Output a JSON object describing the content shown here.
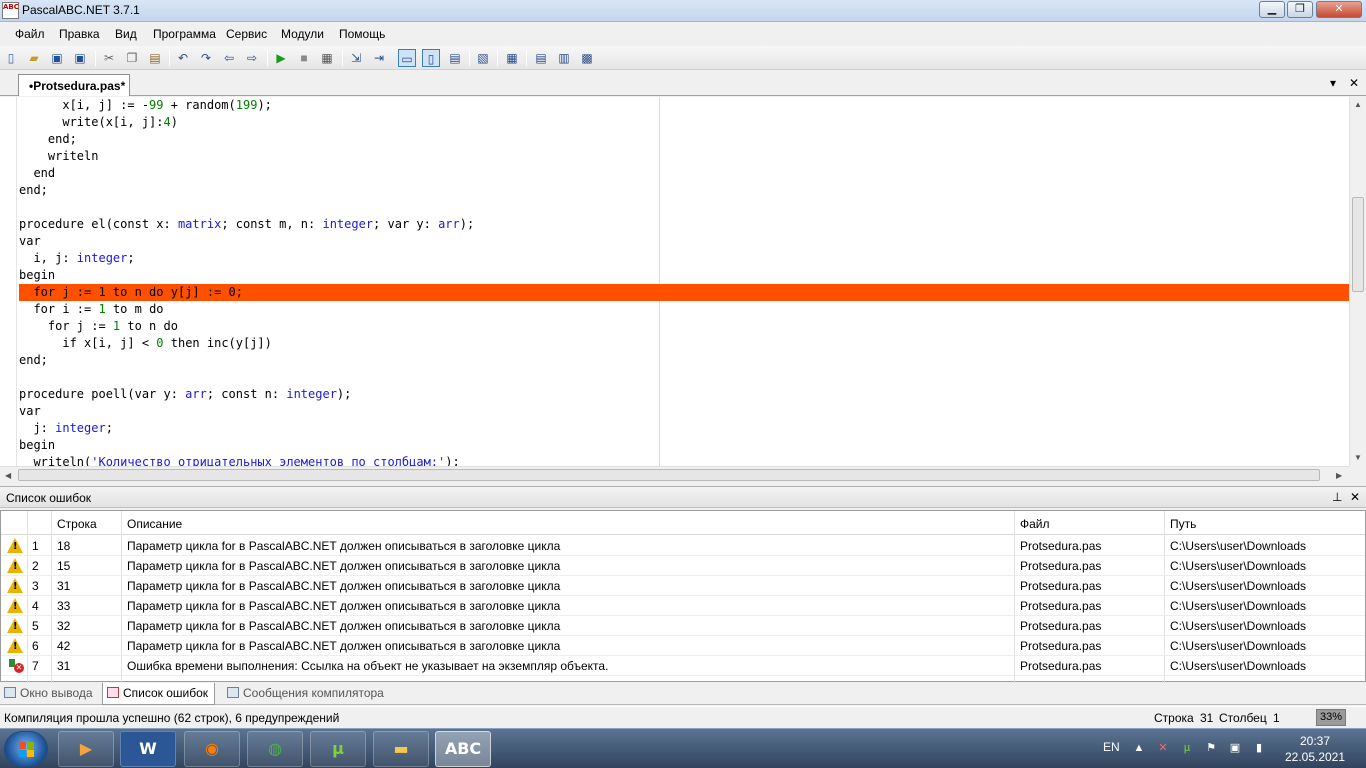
{
  "window": {
    "title": "PascalABC.NET 3.7.1",
    "app_icon": "ABC",
    "minimize": "▁",
    "maximize": "❐",
    "close": "✕"
  },
  "menu": [
    "Файл",
    "Правка",
    "Вид",
    "Программа",
    "Сервис",
    "Модули",
    "Помощь"
  ],
  "toolbar": {
    "icons": [
      "new-file-icon",
      "open-icon",
      "save-icon",
      "save-all-icon",
      "cut-icon",
      "copy-icon",
      "paste-icon",
      "undo-icon",
      "redo-icon",
      "navigate-back-icon",
      "navigate-forward-icon",
      "run-icon",
      "stop-icon",
      "compile-icon",
      "step-into-icon",
      "step-over-icon",
      "output-window-icon",
      "errors-window-icon",
      "watch-icon",
      "debug-icon",
      "format-icon",
      "block-icon-1",
      "block-icon-2",
      "block-icon-3"
    ]
  },
  "tab": {
    "label": "•Protsedura.pas*",
    "menu_glyph": "▾",
    "close_glyph": "✕"
  },
  "editor": {
    "lines": [
      "      x[i, j] := -99 + random(199);",
      "      write(x[i, j]:4)",
      "    end;",
      "    writeln",
      "  end",
      "end;",
      "",
      "procedure el(const x: matrix; const m, n: integer; var y: arr);",
      "var",
      "  i, j: integer;",
      "begin",
      "  for j := 1 to n do y[j] := 0;",
      "  for i := 1 to m do",
      "    for j := 1 to n do",
      "      if x[i, j] < 0 then inc(y[j])",
      "end;",
      "",
      "procedure poell(var y: arr; const n: integer);",
      "var",
      "  j: integer;",
      "begin",
      "  writeln('Количество отрицательных элементов по столбцам:');"
    ],
    "highlight_line_index": 11,
    "highlight_color": "#ff5000"
  },
  "errors_panel": {
    "title": "Список ошибок",
    "pin_glyph": "⊥",
    "close_glyph": "✕",
    "columns": [
      "Строка",
      "Описание",
      "Файл",
      "Путь"
    ],
    "rows": [
      {
        "icon": "warning-icon",
        "num": "1",
        "line": "18",
        "desc": "Параметр цикла for в PascalABC.NET должен описываться в заголовке цикла",
        "file": "Protsedura.pas",
        "path": "C:\\Users\\user\\Downloads"
      },
      {
        "icon": "warning-icon",
        "num": "2",
        "line": "15",
        "desc": "Параметр цикла for в PascalABC.NET должен описываться в заголовке цикла",
        "file": "Protsedura.pas",
        "path": "C:\\Users\\user\\Downloads"
      },
      {
        "icon": "warning-icon",
        "num": "3",
        "line": "31",
        "desc": "Параметр цикла for в PascalABC.NET должен описываться в заголовке цикла",
        "file": "Protsedura.pas",
        "path": "C:\\Users\\user\\Downloads"
      },
      {
        "icon": "warning-icon",
        "num": "4",
        "line": "33",
        "desc": "Параметр цикла for в PascalABC.NET должен описываться в заголовке цикла",
        "file": "Protsedura.pas",
        "path": "C:\\Users\\user\\Downloads"
      },
      {
        "icon": "warning-icon",
        "num": "5",
        "line": "32",
        "desc": "Параметр цикла for в PascalABC.NET должен описываться в заголовке цикла",
        "file": "Protsedura.pas",
        "path": "C:\\Users\\user\\Downloads"
      },
      {
        "icon": "warning-icon",
        "num": "6",
        "line": "42",
        "desc": "Параметр цикла for в PascalABC.NET должен описываться в заголовке цикла",
        "file": "Protsedura.pas",
        "path": "C:\\Users\\user\\Downloads"
      },
      {
        "icon": "runtime-error-icon",
        "num": "7",
        "line": "31",
        "desc": "Ошибка времени выполнения: Ссылка на объект не указывает на экземпляр объекта.",
        "file": "Protsedura.pas",
        "path": "C:\\Users\\user\\Downloads"
      }
    ]
  },
  "bottom_tabs": [
    "Окно вывода",
    "Список ошибок",
    "Сообщения компилятора"
  ],
  "status": {
    "message": "Компиляция прошла успешно (62 строк), 6 предупреждений",
    "row_label": "Строка",
    "row": "31",
    "col_label": "Столбец",
    "col": "1",
    "zoom": "33%"
  },
  "taskbar": {
    "apps": [
      "media-player",
      "word",
      "firefox",
      "chrome",
      "utorrent",
      "explorer",
      "pascalabc"
    ],
    "word_glyph": "W",
    "lang": "EN",
    "time": "20:37",
    "date": "22.05.2021"
  }
}
